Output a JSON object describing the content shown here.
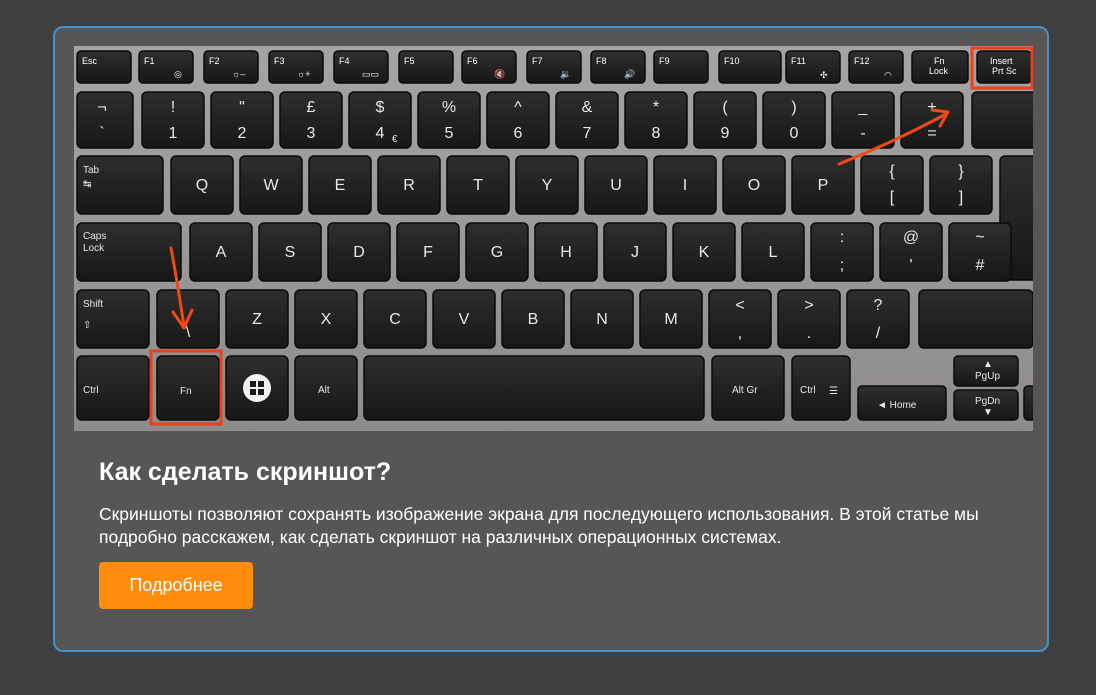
{
  "article": {
    "title": "Как сделать скриншот?",
    "description": "Скриншоты позволяют сохранять изображение экрана для последующего использования. В этой статье мы подробно расскажем, как сделать скриншот на различных операционных системах.",
    "button_label": "Подробнее"
  },
  "keyboard": {
    "fn_row": [
      {
        "top": "Esc",
        "sub": ""
      },
      {
        "top": "F1",
        "sub": ""
      },
      {
        "top": "F2",
        "sub": "☼–"
      },
      {
        "top": "F3",
        "sub": "☼+"
      },
      {
        "top": "F4",
        "sub": "▭▭"
      },
      {
        "top": "F5",
        "sub": ""
      },
      {
        "top": "F6",
        "sub": "🔇"
      },
      {
        "top": "F7",
        "sub": "🔉"
      },
      {
        "top": "F8",
        "sub": "🔊"
      },
      {
        "top": "F9",
        "sub": ""
      },
      {
        "top": "F10",
        "sub": ""
      },
      {
        "top": "F11",
        "sub": ""
      },
      {
        "top": "F12",
        "sub": ""
      },
      {
        "top": "Fn",
        "sub": "Lock"
      },
      {
        "top": "Insert",
        "sub": "Prt Sc"
      }
    ],
    "number_row": [
      {
        "top": "¬",
        "bottom": "`"
      },
      {
        "top": "!",
        "bottom": "1"
      },
      {
        "top": "\"",
        "bottom": "2"
      },
      {
        "top": "£",
        "bottom": "3"
      },
      {
        "top": "$",
        "bottom": "4"
      },
      {
        "top": "%",
        "bottom": "5"
      },
      {
        "top": "^",
        "bottom": "6"
      },
      {
        "top": "&",
        "bottom": "7"
      },
      {
        "top": "*",
        "bottom": "8"
      },
      {
        "top": "(",
        "bottom": "9"
      },
      {
        "top": ")",
        "bottom": "0"
      },
      {
        "top": "_",
        "bottom": "-"
      },
      {
        "top": "+",
        "bottom": "="
      }
    ],
    "euro": "€",
    "tab": "Tab",
    "tab_glyph": "↹",
    "qwerty_row": [
      "Q",
      "W",
      "E",
      "R",
      "T",
      "Y",
      "U",
      "I",
      "O",
      "P"
    ],
    "brace_open": {
      "top": "{",
      "bottom": "["
    },
    "brace_close": {
      "top": "}",
      "bottom": "]"
    },
    "caps": "Caps",
    "caps_sub": "Lock",
    "home_row": [
      "A",
      "S",
      "D",
      "F",
      "G",
      "H",
      "J",
      "K",
      "L"
    ],
    "colon": {
      "top": ":",
      "bottom": ";"
    },
    "at": {
      "top": "@",
      "bottom": "'"
    },
    "hash": {
      "top": "~",
      "bottom": "#"
    },
    "shift": "Shift",
    "shift_glyph": "⇧",
    "backslash": "\\",
    "bottom_row": [
      "Z",
      "X",
      "C",
      "V",
      "B",
      "N",
      "M"
    ],
    "lt": {
      "top": "<",
      "bottom": ","
    },
    "gt": {
      "top": ">",
      "bottom": "."
    },
    "question": {
      "top": "?",
      "bottom": "/"
    },
    "ctrl": "Ctrl",
    "fn": "Fn",
    "alt": "Alt",
    "altgr": "Alt Gr",
    "ctrl_right": "Ctrl",
    "home": "◄ Home",
    "pgup": "PgUp",
    "pgdn": "PgDn",
    "pgup_glyph": "▲",
    "pgdn_glyph": "▼",
    "highlight_color": "#e8411b",
    "arrow_color": "#f04a14"
  }
}
